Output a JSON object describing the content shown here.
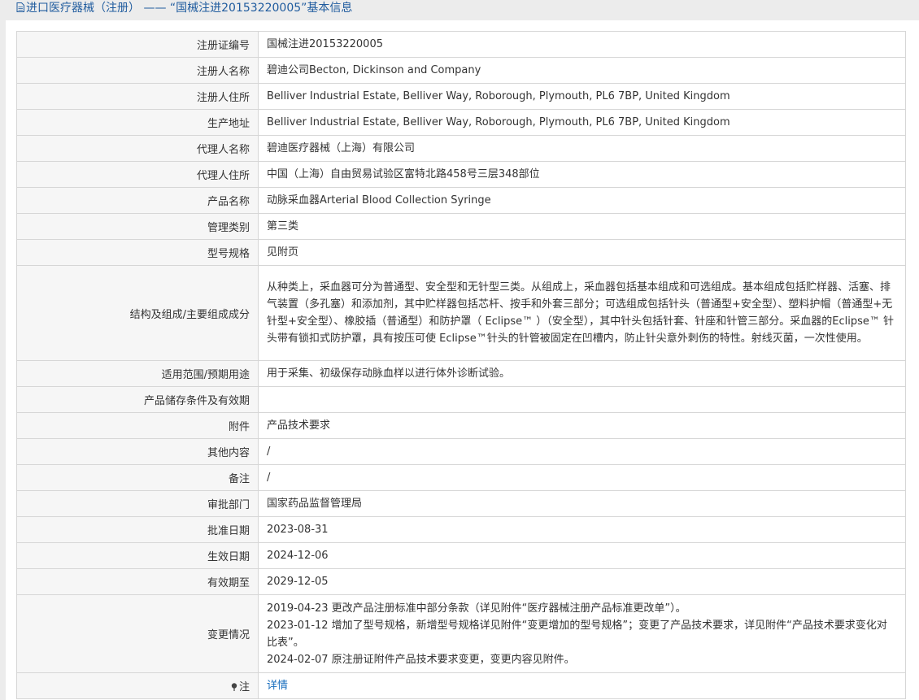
{
  "header": {
    "title": "进口医疗器械（注册） —— “国械注进20153220005”基本信息"
  },
  "rows": [
    {
      "label": "注册证编号",
      "value": "国械注进20153220005"
    },
    {
      "label": "注册人名称",
      "value": "碧迪公司Becton, Dickinson and Company"
    },
    {
      "label": "注册人住所",
      "value": "Belliver Industrial Estate, Belliver Way, Roborough, Plymouth, PL6 7BP, United Kingdom"
    },
    {
      "label": "生产地址",
      "value": "Belliver Industrial Estate, Belliver Way, Roborough, Plymouth, PL6 7BP, United Kingdom"
    },
    {
      "label": "代理人名称",
      "value": "碧迪医疗器械（上海）有限公司"
    },
    {
      "label": "代理人住所",
      "value": "中国（上海）自由贸易试验区富特北路458号三层348部位"
    },
    {
      "label": "产品名称",
      "value": "动脉采血器Arterial Blood Collection Syringe"
    },
    {
      "label": "管理类别",
      "value": "第三类"
    },
    {
      "label": "型号规格",
      "value": "见附页"
    },
    {
      "label": "结构及组成/主要组成成分",
      "value": "从种类上，采血器可分为普通型、安全型和无针型三类。从组成上，采血器包括基本组成和可选组成。基本组成包括贮样器、活塞、排气装置（多孔塞）和添加剂，其中贮样器包括芯杆、按手和外套三部分；可选组成包括针头（普通型+安全型）、塑料护帽（普通型+无针型+安全型）、橡胶插（普通型）和防护罩（ Eclipse™ ）（安全型），其中针头包括针套、针座和针管三部分。采血器的Eclipse™ 针头带有锁扣式防护罩，具有按压可使 Eclipse™针头的针管被固定在凹槽内，防止针尖意外刺伤的特性。射线灭菌，一次性使用。"
    },
    {
      "label": "适用范围/预期用途",
      "value": "用于采集、初级保存动脉血样以进行体外诊断试验。"
    },
    {
      "label": "产品储存条件及有效期",
      "value": ""
    },
    {
      "label": "附件",
      "value": "产品技术要求"
    },
    {
      "label": "其他内容",
      "value": "/"
    },
    {
      "label": "备注",
      "value": "/"
    },
    {
      "label": "审批部门",
      "value": "国家药品监督管理局"
    },
    {
      "label": "批准日期",
      "value": "2023-08-31"
    },
    {
      "label": "生效日期",
      "value": "2024-12-06"
    },
    {
      "label": "有效期至",
      "value": "2029-12-05"
    },
    {
      "label": "变更情况",
      "lines": [
        "2019-04-23 更改产品注册标准中部分条款（详见附件“医疗器械注册产品标准更改单”）。",
        "2023-01-12 增加了型号规格，新增型号规格详见附件“变更增加的型号规格”；变更了产品技术要求，详见附件“产品技术要求变化对比表”。",
        "2024-02-07 原注册证附件产品技术要求变更，变更内容见附件。"
      ]
    },
    {
      "label": "注",
      "value": "详情"
    }
  ],
  "icons": {
    "header": "document-icon",
    "note": "pin-icon"
  },
  "colors": {
    "link": "#1a6fbf",
    "header_text": "#1f5b9e"
  }
}
